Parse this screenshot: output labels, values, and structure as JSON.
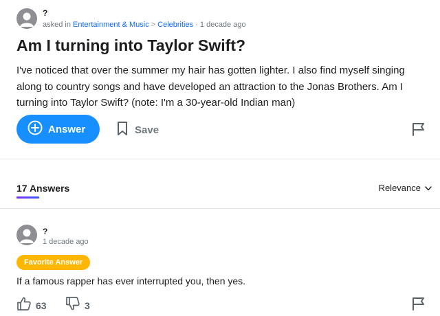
{
  "question": {
    "asker_name": "?",
    "asked_prefix": "asked in",
    "category": "Entertainment & Music",
    "breadcrumb_sep": ">",
    "subcategory": "Celebrities",
    "time_sep": "·",
    "time": "1 decade ago",
    "title": "Am I turning into Taylor Swift?",
    "body": "I've noticed that over the summer my hair has gotten lighter. I also find myself singing along to country songs and have developed an attraction to the Jonas Brothers. Am I turning into Taylor Swift? (note: I'm a 30-year-old Indian man)"
  },
  "actions": {
    "answer_label": "Answer",
    "save_label": "Save"
  },
  "answers_header": {
    "count_label": "17 Answers",
    "sort_label": "Relevance"
  },
  "top_answer": {
    "author_name": "?",
    "time": "1 decade ago",
    "badge": "Favorite Answer",
    "text": "If a famous rapper has ever interrupted you, then yes.",
    "thumbs_up": "63",
    "thumbs_down": "3"
  },
  "icons": {
    "avatar": "user-avatar-icon",
    "answer": "plus-circle-icon",
    "save": "bookmark-icon",
    "report": "flag-icon",
    "sort": "chevron-down-icon",
    "upvote": "thumbs-up-icon",
    "downvote": "thumbs-down-icon"
  },
  "colors": {
    "link": "#0f69ff",
    "primary_button": "#188fff",
    "badge": "#ffb600",
    "muted_text": "#6e7780"
  }
}
